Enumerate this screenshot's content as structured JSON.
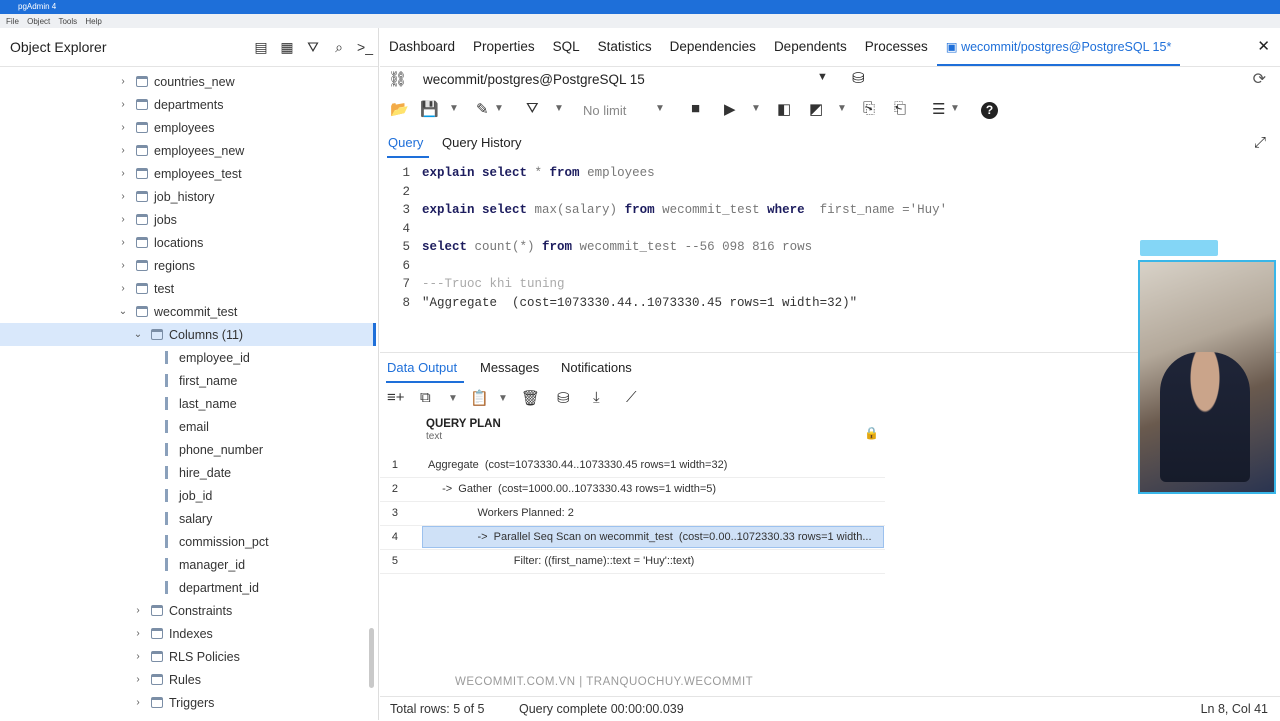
{
  "window": {
    "title": "pgAdmin 4",
    "menu": [
      "File",
      "Object",
      "Tools",
      "Help"
    ]
  },
  "explorer": {
    "title": "Object Explorer",
    "items": [
      {
        "label": "countries_new",
        "kind": "table"
      },
      {
        "label": "departments",
        "kind": "table"
      },
      {
        "label": "employees",
        "kind": "table"
      },
      {
        "label": "employees_new",
        "kind": "table"
      },
      {
        "label": "employees_test",
        "kind": "table"
      },
      {
        "label": "job_history",
        "kind": "table"
      },
      {
        "label": "jobs",
        "kind": "table"
      },
      {
        "label": "locations",
        "kind": "table"
      },
      {
        "label": "regions",
        "kind": "table"
      },
      {
        "label": "test",
        "kind": "table"
      },
      {
        "label": "wecommit_test",
        "kind": "table-open"
      },
      {
        "label": "Columns (11)",
        "kind": "columns"
      },
      {
        "label": "employee_id",
        "kind": "column"
      },
      {
        "label": "first_name",
        "kind": "column"
      },
      {
        "label": "last_name",
        "kind": "column"
      },
      {
        "label": "email",
        "kind": "column"
      },
      {
        "label": "phone_number",
        "kind": "column"
      },
      {
        "label": "hire_date",
        "kind": "column"
      },
      {
        "label": "job_id",
        "kind": "column"
      },
      {
        "label": "salary",
        "kind": "column"
      },
      {
        "label": "commission_pct",
        "kind": "column"
      },
      {
        "label": "manager_id",
        "kind": "column"
      },
      {
        "label": "department_id",
        "kind": "column"
      },
      {
        "label": "Constraints",
        "kind": "group"
      },
      {
        "label": "Indexes",
        "kind": "group"
      },
      {
        "label": "RLS Policies",
        "kind": "group"
      },
      {
        "label": "Rules",
        "kind": "group"
      },
      {
        "label": "Triggers",
        "kind": "group"
      }
    ]
  },
  "tabs": [
    "Dashboard",
    "Properties",
    "SQL",
    "Statistics",
    "Dependencies",
    "Dependents",
    "Processes"
  ],
  "active_tab": "wecommit/postgres@PostgreSQL 15*",
  "connection": "wecommit/postgres@PostgreSQL 15",
  "toolbar": {
    "limit": "No limit"
  },
  "query_tabs": [
    "Query",
    "Query History"
  ],
  "editor": {
    "lines": [
      {
        "n": "1",
        "kw": "explain select",
        "rest": " * ",
        "kw2": "from",
        "rest2": " employees"
      },
      {
        "n": "2"
      },
      {
        "n": "3",
        "kw": "explain select",
        "rest": " max(salary) ",
        "kw2": "from",
        "rest2": " wecommit_test ",
        "kw3": "where",
        "rest3": "  first_name ='Huy'"
      },
      {
        "n": "4"
      },
      {
        "n": "5",
        "kw": "select",
        "rest": " count(*) ",
        "kw2": "from",
        "rest2": " wecommit_test --56 098 816 rows"
      },
      {
        "n": "6"
      },
      {
        "n": "7",
        "comment": "---Truoc khi tuning"
      },
      {
        "n": "8",
        "string": "\"Aggregate  (cost=1073330.44..1073330.45 rows=1 width=32)\""
      }
    ]
  },
  "output_tabs": [
    "Data Output",
    "Messages",
    "Notifications"
  ],
  "grid": {
    "column": "QUERY PLAN",
    "column_type": "text",
    "rows": [
      {
        "n": "1",
        "text": "Aggregate  (cost=1073330.44..1073330.45 rows=1 width=32)"
      },
      {
        "n": "2",
        "text": "  ->  Gather  (cost=1000.00..1073330.43 rows=1 width=5)"
      },
      {
        "n": "3",
        "text": "        Workers Planned: 2"
      },
      {
        "n": "4",
        "text": "        ->  Parallel Seq Scan on wecommit_test  (cost=0.00..1072330.33 rows=1 width..."
      },
      {
        "n": "5",
        "text": "              Filter: ((first_name)::text = 'Huy'::text)"
      }
    ]
  },
  "status": {
    "total_rows": "Total rows: 5 of 5",
    "query_complete": "Query complete 00:00:00.039",
    "cursor": "Ln 8, Col 41"
  },
  "watermark": "WECOMMIT.COM.VN  |  TRANQUOCHUY.WECOMMIT"
}
